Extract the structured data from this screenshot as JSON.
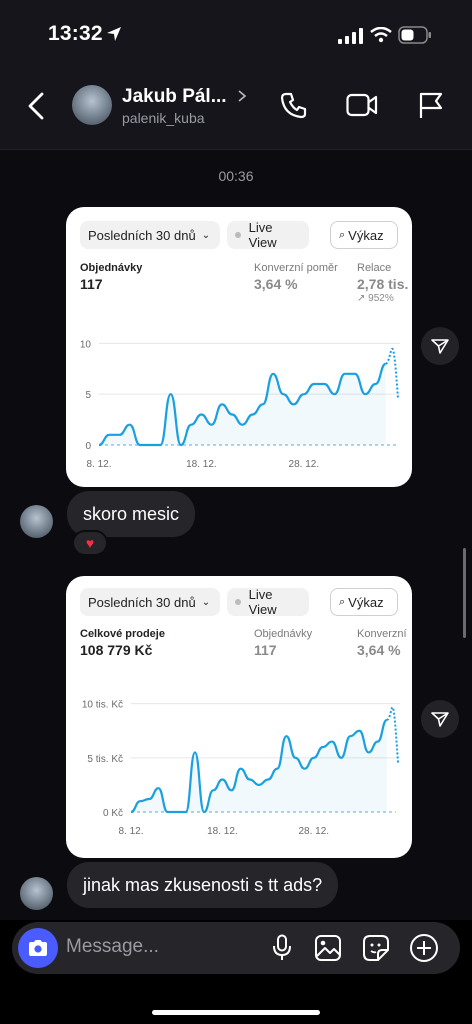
{
  "status_bar": {
    "time": "13:32"
  },
  "header": {
    "name": "Jakub Pál...",
    "handle": "palenik_kuba"
  },
  "chat": {
    "timestamp": "00:36",
    "card1": {
      "period_label": "Posledních 30 dnů",
      "live_view_label": "Live View",
      "report_label": "Výkaz",
      "metric1_label": "Objednávky",
      "metric1_value": "117",
      "metric2_label": "Konverzní poměr",
      "metric2_value": "3,64 %",
      "metric3_label": "Relace",
      "metric3_value": "2,78 tis.",
      "metric3_change": "↗ 952%",
      "y_ticks": [
        "10",
        "5",
        "0"
      ],
      "x_ticks": [
        "8. 12.",
        "18. 12.",
        "28. 12."
      ]
    },
    "message1": "skoro mesic",
    "reaction1": "❤️",
    "card2": {
      "period_label": "Posledních 30 dnů",
      "live_view_label": "Live View",
      "report_label": "Výkaz",
      "metric1_label": "Celkové prodeje",
      "metric1_value": "108 779 Kč",
      "metric2_label": "Objednávky",
      "metric2_value": "117",
      "metric3_label": "Konverzní",
      "metric3_value": "3,64 %",
      "y_ticks": [
        "10 tis. Kč",
        "5 tis. Kč",
        "0 Kč"
      ],
      "x_ticks": [
        "8. 12.",
        "18. 12.",
        "28. 12."
      ]
    },
    "message2": "jinak mas zkusenosti s tt ads?"
  },
  "composer": {
    "placeholder": "Message..."
  },
  "colors": {
    "accent": "#4a5cff",
    "chart_line": "#1a9fe0",
    "bubble": "#26252a"
  },
  "chart_data": [
    {
      "type": "line",
      "title": "Objednávky",
      "x": [
        1,
        2,
        3,
        4,
        5,
        6,
        7,
        8,
        9,
        10,
        11,
        12,
        13,
        14,
        15,
        16,
        17,
        18,
        19,
        20,
        21,
        22,
        23,
        24,
        25,
        26,
        27,
        28,
        29,
        30
      ],
      "series": [
        {
          "values": [
            0,
            1,
            1,
            2,
            0,
            0,
            0,
            5,
            0,
            2,
            3,
            2,
            4,
            3,
            2,
            3,
            4,
            7,
            5,
            4,
            5,
            6,
            6,
            5,
            7,
            7,
            5,
            6,
            8,
            12
          ]
        }
      ],
      "ylim": [
        0,
        12
      ],
      "x_tick_labels": [
        "8. 12.",
        "18. 12.",
        "28. 12."
      ]
    },
    {
      "type": "line",
      "title": "Celkové prodeje",
      "x": [
        1,
        2,
        3,
        4,
        5,
        6,
        7,
        8,
        9,
        10,
        11,
        12,
        13,
        14,
        15,
        16,
        17,
        18,
        19,
        20,
        21,
        22,
        23,
        24,
        25,
        26,
        27,
        28,
        29,
        30
      ],
      "series": [
        {
          "values": [
            0,
            1000,
            1200,
            2200,
            0,
            0,
            0,
            5500,
            0,
            2000,
            3000,
            2000,
            4000,
            3000,
            2500,
            3000,
            4000,
            7000,
            5000,
            4000,
            5000,
            6000,
            6500,
            5000,
            7000,
            7500,
            5500,
            6500,
            8500,
            12000
          ]
        }
      ],
      "ylim": [
        0,
        12000
      ],
      "x_tick_labels": [
        "8. 12.",
        "18. 12.",
        "28. 12."
      ]
    }
  ]
}
